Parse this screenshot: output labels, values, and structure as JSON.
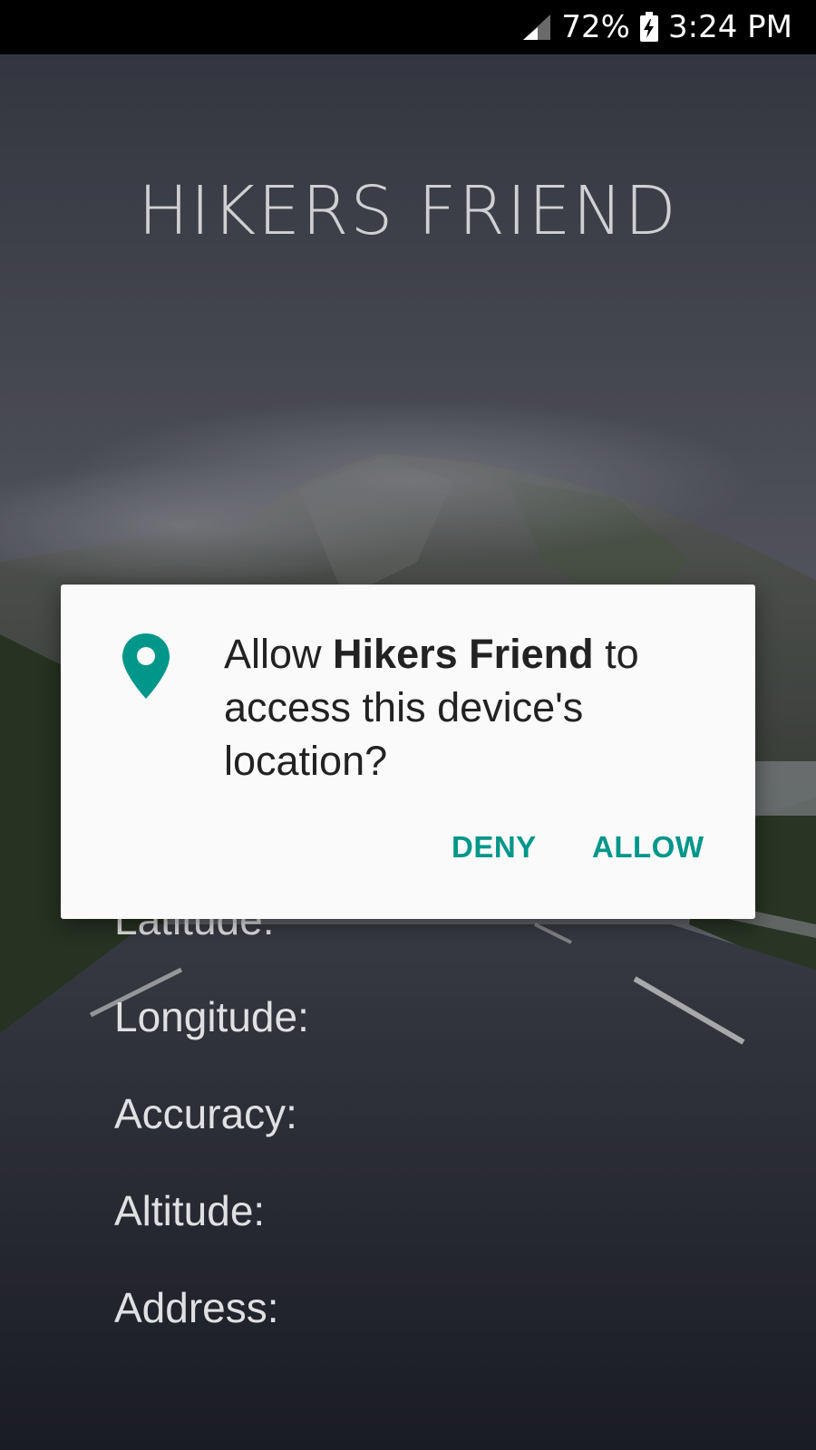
{
  "status_bar": {
    "battery_percent": "72%",
    "time": "3:24 PM",
    "icons": [
      "signal-icon",
      "battery-charging-icon"
    ]
  },
  "app": {
    "title": "HIKERS FRIEND"
  },
  "info_labels": [
    "Latitude:",
    "Longitude:",
    "Accuracy:",
    "Altitude:",
    "Address:"
  ],
  "dialog": {
    "icon": "location-pin-icon",
    "message_prefix": "Allow ",
    "app_name": "Hikers Friend",
    "message_suffix": " to access this device's location?",
    "deny_label": "DENY",
    "allow_label": "ALLOW"
  },
  "colors": {
    "accent": "#00968A",
    "dialog_bg": "#FAFAFA",
    "status_bar_bg": "#000000"
  }
}
